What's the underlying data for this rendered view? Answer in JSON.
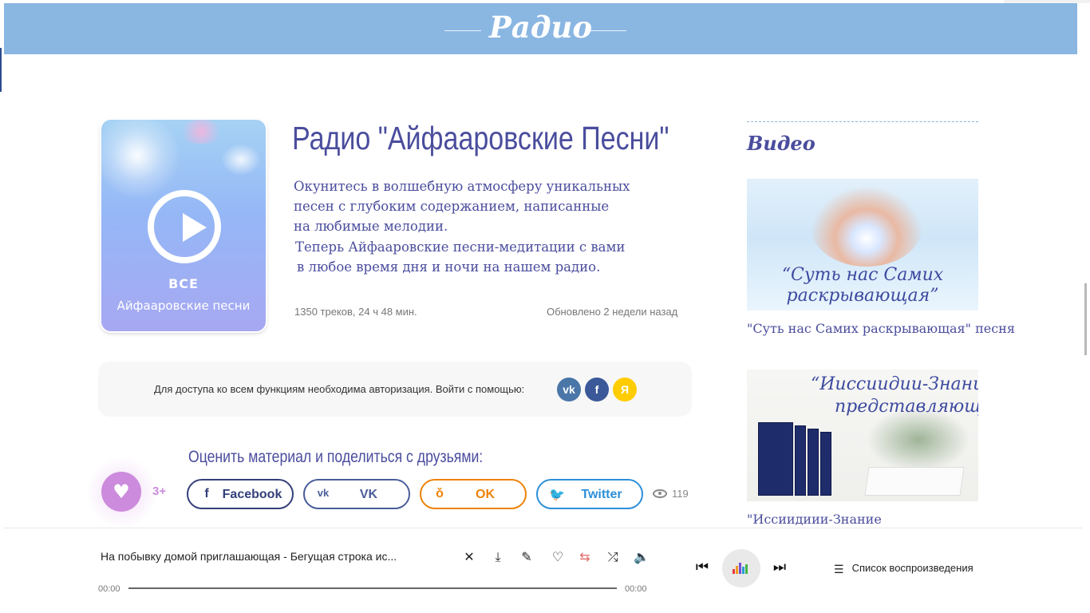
{
  "header": {
    "title": "Радио"
  },
  "cover": {
    "line1": "ВСЕ",
    "line2": "Айфааровские песни"
  },
  "main": {
    "title": "Радио \"Айфааровские Песни\"",
    "description": [
      "Окунитесь в волшебную атмосферу уникальных",
      "песен с глубоким содержанием,  написанные",
      "на любимые мелодии.",
      "Теперь Айфааровские песни-медитации с вами",
      "в любое время дня и ночи на  нашем радио."
    ],
    "stats": "1350 треков,  24 ч 48 мин.",
    "updated": "Обновлено 2 недели назад"
  },
  "auth": {
    "text": "Для доступа ко всем функциям необходима авторизация. Войти с помощью:",
    "providers": [
      {
        "label": "vk",
        "color": "#4a76a8"
      },
      {
        "label": "f",
        "color": "#3b5998"
      },
      {
        "label": "Я",
        "color": "#ffcc00"
      }
    ]
  },
  "share": {
    "prompt": "Оценить материал и поделиться с друзьями:",
    "likes": "3+",
    "buttons": [
      {
        "label": "Facebook",
        "icon": "facebook-icon",
        "color": "#34407a"
      },
      {
        "label": "VK",
        "icon": "vk-icon",
        "color": "#4a5d9a"
      },
      {
        "label": "OK",
        "icon": "odnoklassniki-icon",
        "color": "#ee8208"
      },
      {
        "label": "Twitter",
        "icon": "twitter-icon",
        "color": "#2d8fd8"
      }
    ],
    "views": "119"
  },
  "sidebar": {
    "title": "Видео",
    "videos": [
      {
        "caption_lines": [
          "“Суть нас Самих",
          "раскрывающая”"
        ],
        "link": "\"Суть нас Самих раскрывающая\" песня"
      },
      {
        "caption_lines": [
          "“Ииссиидии-Знание",
          "представляющая”"
        ],
        "link": "\"Иссиидиии-Знание"
      }
    ]
  },
  "player": {
    "track": "На побывку домой приглашающая  - Бегущая строка ис...",
    "time_current": "00:00",
    "time_total": "00:00",
    "progress": 0,
    "playlist_label": "Список  воспроизведения",
    "accent": "#e26a6a"
  }
}
